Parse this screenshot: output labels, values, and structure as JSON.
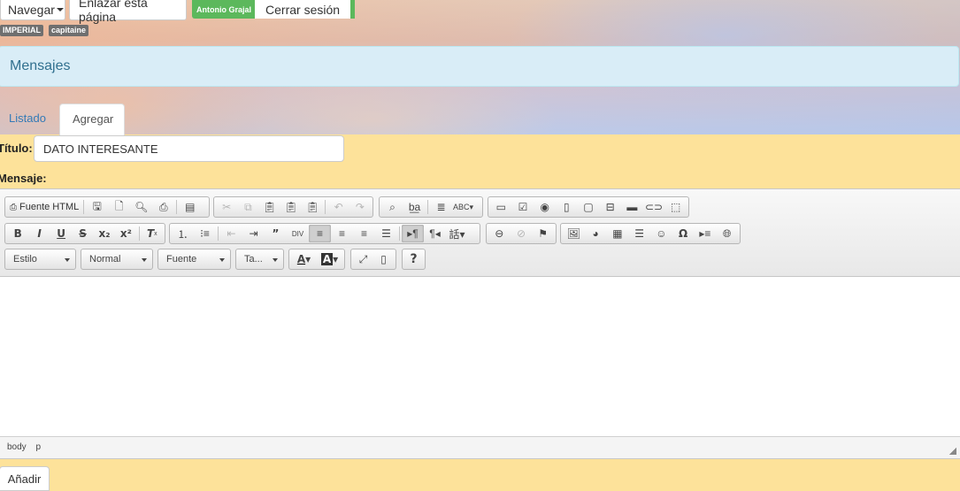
{
  "nav": {
    "navegar": "Navegar",
    "enlazar": "Enlazar esta página",
    "user": "Antonio Grajal",
    "logout": "Cerrar sesión"
  },
  "badges": [
    "IMPERIAL",
    "capitaine"
  ],
  "panel": {
    "title": "Mensajes"
  },
  "tabs": {
    "listado": "Listado",
    "agregar": "Agregar"
  },
  "form": {
    "titulo_label": "Título:",
    "titulo_value": "DATO INTERESANTE",
    "mensaje_label": "Mensaje:",
    "submit_label": "Añadir"
  },
  "editor": {
    "source_label": "Fuente HTML",
    "combos": {
      "style": "Estilo",
      "format": "Normal",
      "font": "Fuente",
      "size": "Ta..."
    },
    "path": [
      "body",
      "p"
    ]
  },
  "colors": {
    "page_bg": "#fde29a",
    "panel_bg": "#d9edf7",
    "panel_text": "#31708f",
    "link": "#337ab7",
    "user_badge": "#5cb85c"
  }
}
